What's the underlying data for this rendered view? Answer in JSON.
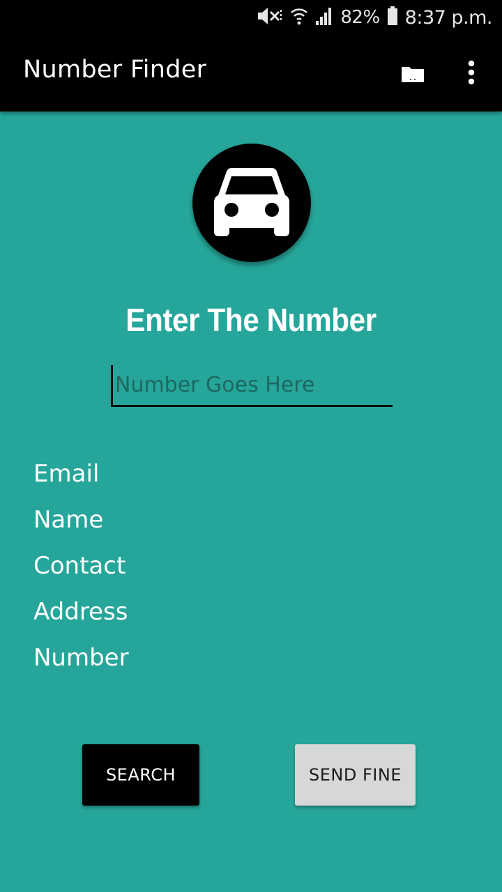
{
  "status_bar": {
    "battery": "82%",
    "time": "8:37 p.m."
  },
  "app_bar": {
    "title": "Number Finder",
    "icons": [
      "folder-icon",
      "more-vert-icon"
    ]
  },
  "main": {
    "avatar_icon": "car-icon",
    "heading": "Enter The Number",
    "number_input": {
      "placeholder": "Number Goes Here",
      "value": ""
    },
    "details": [
      "Email",
      "Name",
      "Contact",
      "Address",
      "Number"
    ]
  },
  "buttons": {
    "search": "SEARCH",
    "send_fine": "SEND FINE"
  },
  "colors": {
    "background": "#26a69a",
    "app_bar": "#000000",
    "search_button": "#000000",
    "send_fine_button": "#d6d7d7"
  }
}
